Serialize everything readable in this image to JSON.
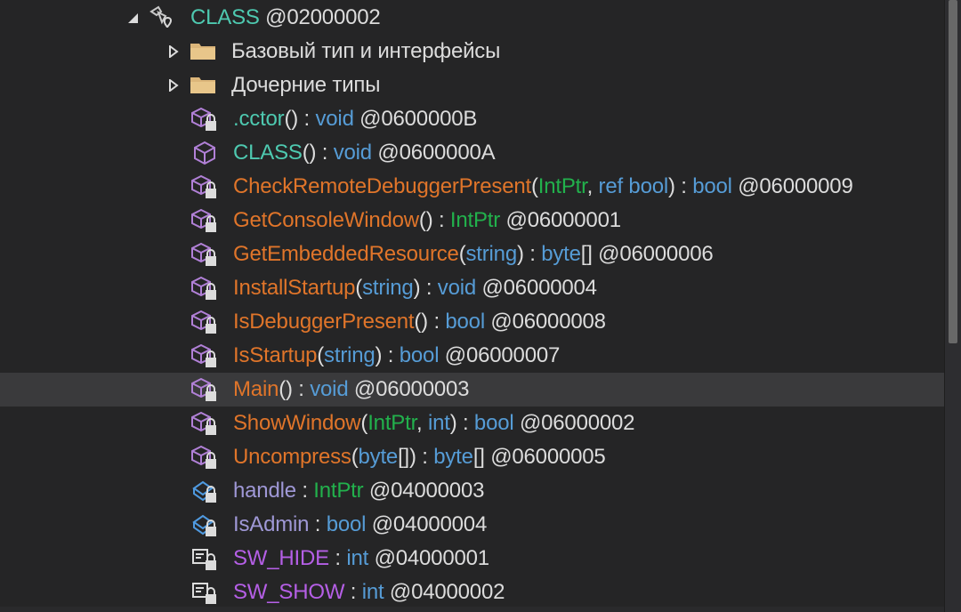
{
  "tree": {
    "rows": [
      {
        "kind": "class",
        "segments": [
          {
            "text": "CLASS",
            "role": "cls"
          },
          {
            "text": " @02000002",
            "role": "token"
          }
        ]
      },
      {
        "kind": "folder",
        "segments": [
          {
            "text": "Базовый тип и интерфейсы",
            "role": "default"
          }
        ]
      },
      {
        "kind": "folder",
        "segments": [
          {
            "text": "Дочерние типы",
            "role": "default"
          }
        ]
      },
      {
        "kind": "method-private",
        "segments": [
          {
            "text": ".cctor",
            "role": "cls"
          },
          {
            "text": "() : ",
            "role": "default"
          },
          {
            "text": "void",
            "role": "kw"
          },
          {
            "text": " @0600000B",
            "role": "token"
          }
        ]
      },
      {
        "kind": "method-public",
        "segments": [
          {
            "text": "CLASS",
            "role": "cls"
          },
          {
            "text": "() : ",
            "role": "default"
          },
          {
            "text": "void",
            "role": "kw"
          },
          {
            "text": " @0600000A",
            "role": "token"
          }
        ]
      },
      {
        "kind": "method-private",
        "segments": [
          {
            "text": "CheckRemoteDebuggerPresent",
            "role": "method"
          },
          {
            "text": "(",
            "role": "default"
          },
          {
            "text": "IntPtr",
            "role": "type"
          },
          {
            "text": ", ",
            "role": "default"
          },
          {
            "text": "ref bool",
            "role": "kw"
          },
          {
            "text": ") : ",
            "role": "default"
          },
          {
            "text": "bool",
            "role": "kw"
          },
          {
            "text": " @06000009",
            "role": "token"
          }
        ]
      },
      {
        "kind": "method-private",
        "segments": [
          {
            "text": "GetConsoleWindow",
            "role": "method"
          },
          {
            "text": "() : ",
            "role": "default"
          },
          {
            "text": "IntPtr",
            "role": "type"
          },
          {
            "text": " @06000001",
            "role": "token"
          }
        ]
      },
      {
        "kind": "method-private",
        "segments": [
          {
            "text": "GetEmbeddedResource",
            "role": "method"
          },
          {
            "text": "(",
            "role": "default"
          },
          {
            "text": "string",
            "role": "kw"
          },
          {
            "text": ") : ",
            "role": "default"
          },
          {
            "text": "byte",
            "role": "kw"
          },
          {
            "text": "[] @06000006",
            "role": "token"
          }
        ]
      },
      {
        "kind": "method-private",
        "segments": [
          {
            "text": "InstallStartup",
            "role": "method"
          },
          {
            "text": "(",
            "role": "default"
          },
          {
            "text": "string",
            "role": "kw"
          },
          {
            "text": ") : ",
            "role": "default"
          },
          {
            "text": "void",
            "role": "kw"
          },
          {
            "text": " @06000004",
            "role": "token"
          }
        ]
      },
      {
        "kind": "method-private",
        "segments": [
          {
            "text": "IsDebuggerPresent",
            "role": "method"
          },
          {
            "text": "() : ",
            "role": "default"
          },
          {
            "text": "bool",
            "role": "kw"
          },
          {
            "text": " @06000008",
            "role": "token"
          }
        ]
      },
      {
        "kind": "method-private",
        "segments": [
          {
            "text": "IsStartup",
            "role": "method"
          },
          {
            "text": "(",
            "role": "default"
          },
          {
            "text": "string",
            "role": "kw"
          },
          {
            "text": ") : ",
            "role": "default"
          },
          {
            "text": "bool",
            "role": "kw"
          },
          {
            "text": " @06000007",
            "role": "token"
          }
        ]
      },
      {
        "kind": "method-private",
        "selected": true,
        "segments": [
          {
            "text": "Main",
            "role": "method"
          },
          {
            "text": "() : ",
            "role": "default"
          },
          {
            "text": "void",
            "role": "kw"
          },
          {
            "text": " @06000003",
            "role": "token"
          }
        ]
      },
      {
        "kind": "method-private",
        "segments": [
          {
            "text": "ShowWindow",
            "role": "method"
          },
          {
            "text": "(",
            "role": "default"
          },
          {
            "text": "IntPtr",
            "role": "type"
          },
          {
            "text": ", ",
            "role": "default"
          },
          {
            "text": "int",
            "role": "kw"
          },
          {
            "text": ") : ",
            "role": "default"
          },
          {
            "text": "bool",
            "role": "kw"
          },
          {
            "text": " @06000002",
            "role": "token"
          }
        ]
      },
      {
        "kind": "method-private",
        "segments": [
          {
            "text": "Uncompress",
            "role": "method"
          },
          {
            "text": "(",
            "role": "default"
          },
          {
            "text": "byte",
            "role": "kw"
          },
          {
            "text": "[]) : ",
            "role": "default"
          },
          {
            "text": "byte",
            "role": "kw"
          },
          {
            "text": "[] @06000005",
            "role": "token"
          }
        ]
      },
      {
        "kind": "field-private",
        "segments": [
          {
            "text": "handle",
            "role": "field"
          },
          {
            "text": " : ",
            "role": "default"
          },
          {
            "text": "IntPtr",
            "role": "type"
          },
          {
            "text": " @04000003",
            "role": "token"
          }
        ]
      },
      {
        "kind": "field-private",
        "segments": [
          {
            "text": "IsAdmin",
            "role": "field"
          },
          {
            "text": " : ",
            "role": "default"
          },
          {
            "text": "bool",
            "role": "kw"
          },
          {
            "text": " @04000004",
            "role": "token"
          }
        ]
      },
      {
        "kind": "const-private",
        "segments": [
          {
            "text": "SW_HIDE",
            "role": "const"
          },
          {
            "text": " : ",
            "role": "default"
          },
          {
            "text": "int",
            "role": "kw"
          },
          {
            "text": " @04000001",
            "role": "token"
          }
        ]
      },
      {
        "kind": "const-private",
        "segments": [
          {
            "text": "SW_SHOW",
            "role": "const"
          },
          {
            "text": " : ",
            "role": "default"
          },
          {
            "text": "int",
            "role": "kw"
          },
          {
            "text": " @04000002",
            "role": "token"
          }
        ]
      }
    ]
  },
  "colors": {
    "background": "#252526",
    "selected_row": "#3a3a3c",
    "class_name": "#4ec9b0",
    "method_name": "#e0752a",
    "keyword": "#569cd6",
    "type_name": "#22b14c",
    "field_name": "#9f98d6",
    "constant_name": "#b55fe6",
    "default_text": "#dcdcdc"
  },
  "icons": {
    "class": "class-icon",
    "folder": "folder-icon",
    "method-private": "method-private-icon",
    "method-public": "method-icon",
    "field-private": "field-private-icon",
    "const-private": "constant-private-icon"
  }
}
